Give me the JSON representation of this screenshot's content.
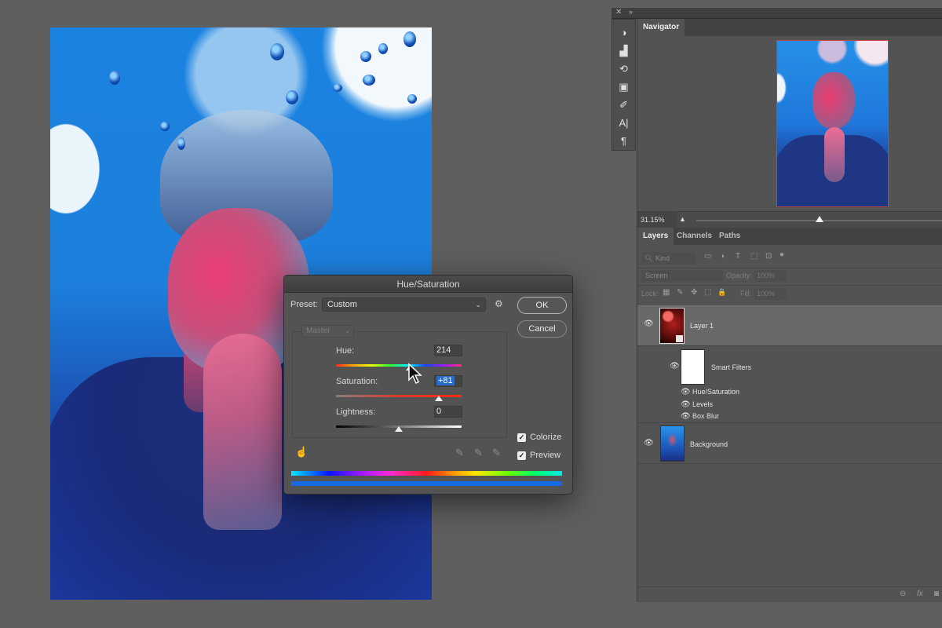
{
  "canvas": {
    "description": "Photo of man praying, blue and pink tones with water drops"
  },
  "dialog": {
    "title": "Hue/Saturation",
    "preset_label": "Preset:",
    "preset_value": "Custom",
    "ok_label": "OK",
    "cancel_label": "Cancel",
    "channel_value": "Master",
    "hue_label": "Hue:",
    "hue_value": "214",
    "hue_slider_fraction": 0.59,
    "saturation_label": "Saturation:",
    "saturation_value": "+81",
    "saturation_slider_fraction": 0.82,
    "lightness_label": "Lightness:",
    "lightness_value": "0",
    "lightness_slider_fraction": 0.5,
    "colorize_label": "Colorize",
    "colorize_checked": true,
    "preview_label": "Preview",
    "preview_checked": true,
    "icons": {
      "gear": "⚙",
      "checkmark": "✓",
      "hand": "☝",
      "eyedropper": "✎",
      "eyedropper_plus": "✎",
      "eyedropper_minus": "✎",
      "chevron": "⌄"
    }
  },
  "tool_strip": {
    "close": "✕",
    "collapse": "»",
    "icons": [
      "◑",
      "▟",
      "⟲",
      "▣",
      "✐",
      "A|",
      "¶"
    ]
  },
  "navigator": {
    "tab": "Navigator",
    "zoom_value": "31.15%",
    "zoom_slider_fraction": 0.5
  },
  "layers_panel": {
    "tabs": [
      "Layers",
      "Channels",
      "Paths"
    ],
    "kind_placeholder": "Kind",
    "filter_icons": [
      "▭",
      "◑",
      "T",
      "⬚",
      "⊡",
      "●"
    ],
    "blend_mode": "Screen",
    "opacity_label": "Opacity:",
    "opacity_value": "100%",
    "lock_label": "Lock:",
    "lock_icons": [
      "▦",
      "✎",
      "✥",
      "⬚",
      "🔒"
    ],
    "fill_label": "Fill:",
    "fill_value": "100%",
    "layers": [
      {
        "name": "Layer 1",
        "selected": true
      },
      {
        "name": "Smart Filters"
      },
      {
        "name": "Hue/Saturation"
      },
      {
        "name": "Levels"
      },
      {
        "name": "Box Blur"
      },
      {
        "name": "Background"
      }
    ],
    "eye_icon": "👁",
    "footer_icons": [
      "⊖",
      "fx",
      "◙"
    ]
  }
}
